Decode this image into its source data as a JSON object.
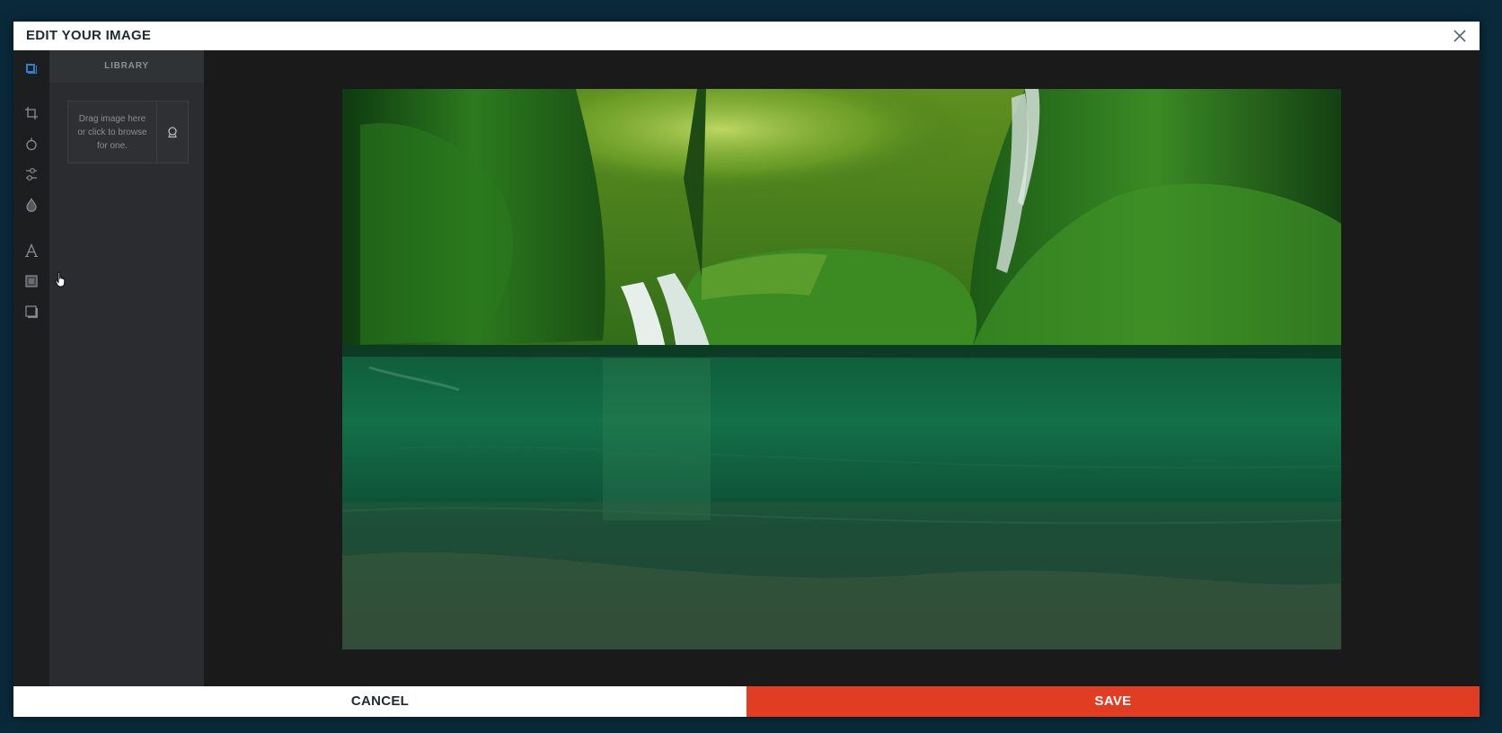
{
  "header": {
    "title": "EDIT YOUR IMAGE",
    "close_icon": "close-icon"
  },
  "toolbar": {
    "tools": [
      {
        "name": "image-library",
        "icon": "image-library-icon",
        "active": true
      },
      {
        "name": "crop",
        "icon": "crop-icon"
      },
      {
        "name": "filter",
        "icon": "filter-icon"
      },
      {
        "name": "adjust",
        "icon": "adjust-icon"
      },
      {
        "name": "color",
        "icon": "drop-icon"
      },
      {
        "name": "text",
        "icon": "text-icon"
      },
      {
        "name": "overlay",
        "icon": "overlay-icon"
      },
      {
        "name": "frame",
        "icon": "frame-icon"
      }
    ]
  },
  "panel": {
    "tab_label": "LIBRARY",
    "dropzone_text": "Drag image here or click to browse for one.",
    "search_icon": "search-icon"
  },
  "footer": {
    "cancel_label": "CANCEL",
    "save_label": "SAVE"
  },
  "colors": {
    "backdrop": "#0a2a3b",
    "save": "#e03d22",
    "active_tool": "#2a7fd4"
  }
}
